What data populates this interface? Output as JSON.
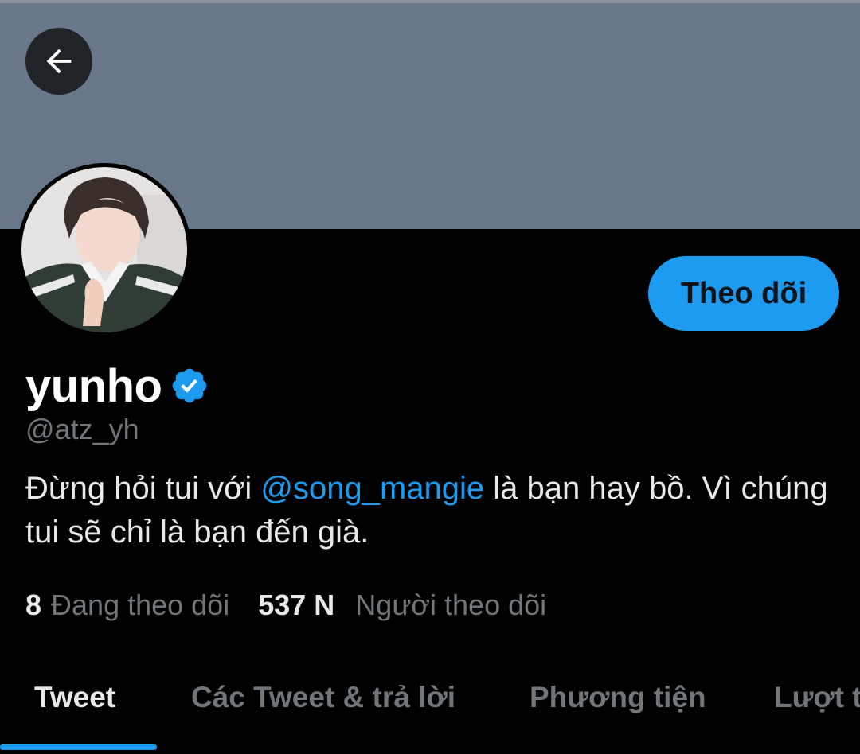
{
  "profile": {
    "display_name": "yunho",
    "handle": "@atz_yh",
    "bio_before": "Đừng hỏi tui với ",
    "bio_mention": "@song_mangie",
    "bio_after": " là bạn hay bồ. Vì chúng tui sẽ chỉ là bạn đến già.",
    "verified": true
  },
  "actions": {
    "follow_label": "Theo dõi"
  },
  "stats": {
    "following_count": "8",
    "following_label": "Đang theo dõi",
    "followers_count": "537 N",
    "followers_label": "Người theo dõi"
  },
  "tabs": [
    {
      "label": "Tweet",
      "active": true
    },
    {
      "label": "Các Tweet & trả lời",
      "active": false
    },
    {
      "label": "Phương tiện",
      "active": false
    },
    {
      "label": "Lượt t",
      "active": false
    }
  ],
  "icons": {
    "back": "arrow-left-icon",
    "verified": "verified-badge-icon"
  },
  "colors": {
    "accent": "#1d9bf0",
    "banner": "#66788a",
    "background": "#000000",
    "secondary_text": "#71767b"
  }
}
